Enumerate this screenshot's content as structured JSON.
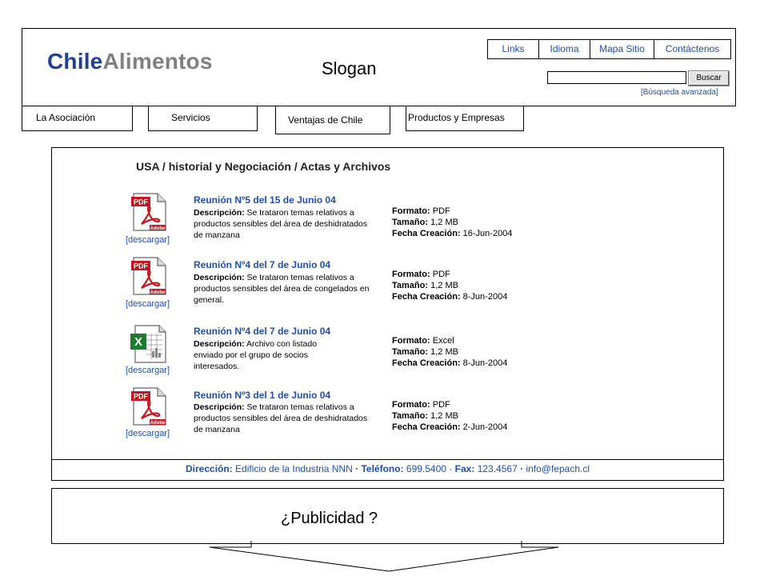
{
  "logo": {
    "part1": "Chile",
    "part2": "Alimentos"
  },
  "slogan": "Slogan",
  "top_links": [
    "Links",
    "Idioma",
    "Mapa Sitio",
    "Contáctenos"
  ],
  "search": {
    "value": "",
    "button_label": "Buscar",
    "advanced_link": "[Búsqueda avanzada]"
  },
  "nav_tabs": [
    "La Asociación",
    "Servicios",
    "Ventajas de Chile",
    "Productos y Empresas"
  ],
  "section_title": "USA / historial y Negociación / Actas y Archivos",
  "labels": {
    "description": "Descripción:",
    "format": "Formato:",
    "size": "Tamaño:",
    "created": "Fecha Creación:",
    "download": "[descargar]"
  },
  "documents": [
    {
      "icon": "pdf-icon",
      "title": "Reunión Nº5 del 15 de Junio 04",
      "description": "Se trataron temas relativos a productos sensibles del área de deshidratados de manzana",
      "format": "PDF",
      "size": "1,2 MB",
      "created": "16-Jun-2004"
    },
    {
      "icon": "pdf-icon",
      "title": "Reunión Nº4 del 7 de Junio 04",
      "description": "Se trataron temas relativos a productos sensibles del área de congelados en general.",
      "format": "PDF",
      "size": "1,2 MB",
      "created": "8-Jun-2004"
    },
    {
      "icon": "excel-icon",
      "title": "Reunión Nº4 del 7 de Junio 04",
      "description": "Archivo con listado enviado por el grupo de socios interesados.",
      "format": "Excel",
      "size": "1,2 MB",
      "created": "8-Jun-2004"
    },
    {
      "icon": "pdf-icon",
      "title": "Reunión Nº3 del 1 de Junio 04",
      "description": "Se trataron temas relativos a productos sensibles del área de deshidratados de manzana",
      "format": "PDF",
      "size": "1,2 MB",
      "created": "2-Jun-2004"
    }
  ],
  "footer": {
    "address_label": "Dirección:",
    "address": "Edificio de la Industria NNN",
    "phone_label": "Teléfono:",
    "phone": "699.5400",
    "fax_label": "Fax:",
    "fax": "123.4567",
    "email": "info@fepach.cl"
  },
  "ad_text": "¿Publicidad ?",
  "colors": {
    "link": "#1f4fb0",
    "logo_primary": "#1f3f9a",
    "logo_secondary": "#808080",
    "pdf_red": "#c4161c",
    "excel_green": "#1e7a2e"
  }
}
